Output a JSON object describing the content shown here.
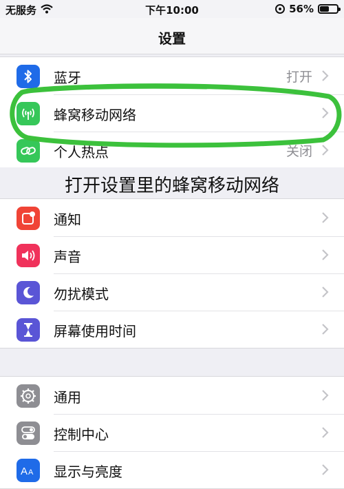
{
  "status_bar": {
    "carrier": "无服务",
    "time": "下午10:00",
    "battery_percent": "56%",
    "battery_level": 0.56,
    "icons": [
      "wifi-icon",
      "orientation-lock-icon",
      "battery-icon"
    ]
  },
  "nav": {
    "title": "设置"
  },
  "group1": {
    "items": [
      {
        "label": "蓝牙",
        "value": "打开",
        "icon": "bluetooth-icon",
        "color": "#1f6be8"
      },
      {
        "label": "蜂窝移动网络",
        "value": "",
        "icon": "cellular-antenna-icon",
        "color": "#36c759"
      },
      {
        "label": "个人热点",
        "value": "关闭",
        "icon": "hotspot-chain-icon",
        "color": "#36c759"
      }
    ]
  },
  "caption": "打开设置里的蜂窝移动网络",
  "group2": {
    "items": [
      {
        "label": "通知",
        "icon": "notification-icon",
        "color": "#f04436"
      },
      {
        "label": "声音",
        "icon": "speaker-icon",
        "color": "#f0325b"
      },
      {
        "label": "勿扰模式",
        "icon": "moon-icon",
        "color": "#5a55d6"
      },
      {
        "label": "屏幕使用时间",
        "icon": "hourglass-icon",
        "color": "#5a55d6"
      }
    ]
  },
  "group3": {
    "items": [
      {
        "label": "通用",
        "icon": "gear-icon",
        "color": "#8e8e93"
      },
      {
        "label": "控制中心",
        "icon": "toggles-icon",
        "color": "#8e8e93"
      },
      {
        "label": "显示与亮度",
        "icon": "text-size-icon",
        "color": "#1f6be8"
      }
    ]
  },
  "annotation": {
    "highlight_color": "#3cc13c"
  }
}
